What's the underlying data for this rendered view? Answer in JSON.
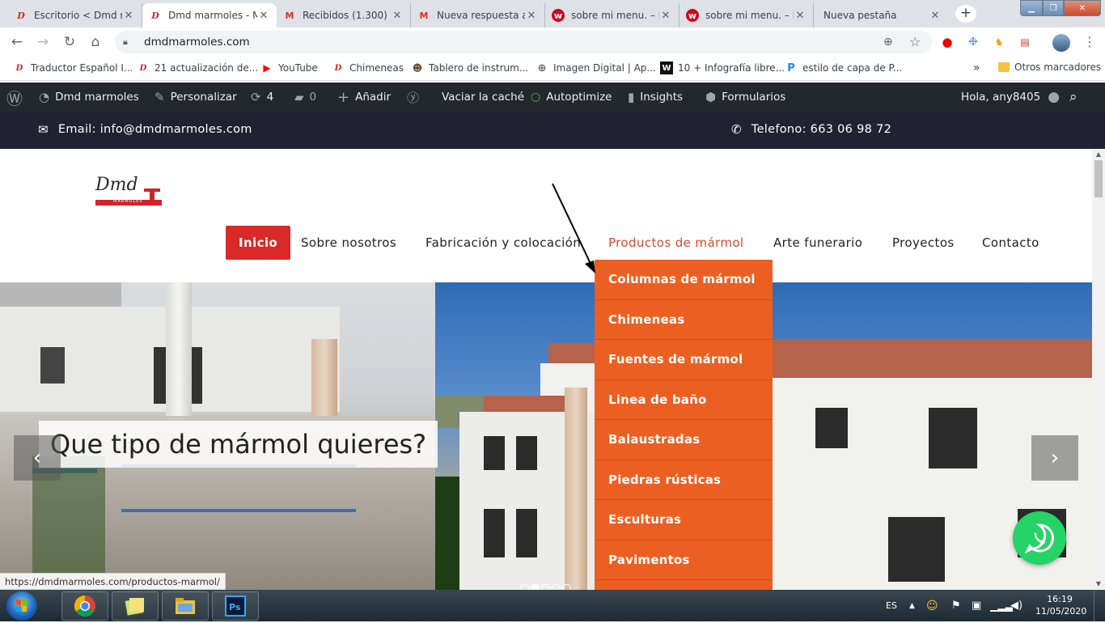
{
  "browser": {
    "tabs": [
      {
        "title": "Escritorio < Dmd m",
        "icon": "wp-icon"
      },
      {
        "title": "Dmd marmoles - M",
        "icon": "wp-icon",
        "active": true
      },
      {
        "title": "Recibidos (1.300) -",
        "icon": "gmail-icon"
      },
      {
        "title": "Nueva respuesta a",
        "icon": "gmail-icon"
      },
      {
        "title": "sobre mi menu. – P",
        "icon": "w-icon"
      },
      {
        "title": "sobre mi menu. – P",
        "icon": "w-icon"
      },
      {
        "title": "Nueva pestaña",
        "icon": ""
      }
    ],
    "new_tab": "+",
    "url": "dmdmarmoles.com",
    "bookmarks": [
      "Traductor Español I...",
      "21 actualización de...",
      "YouTube",
      "Chimeneas",
      "Tablero de instrum...",
      "Imagen Digital | Ap...",
      "10 + Infografía libre...",
      "estilo de capa de P..."
    ],
    "bookmarks_more": "»",
    "other_bookmarks": "Otros marcadores"
  },
  "wp_admin": {
    "site": "Dmd marmoles",
    "customize": "Personalizar",
    "updates": "4",
    "comments": "0",
    "add": "Añadir",
    "cache": "Vaciar la caché",
    "autoptimize": "Autoptimize",
    "insights": "Insights",
    "forms": "Formularios",
    "greeting": "Hola, any8405"
  },
  "topbar": {
    "email": "Email: info@dmdmarmoles.com",
    "phone": "Telefono: 663 06 98 72"
  },
  "logo": {
    "text": "Dmd",
    "sub": "MARMOLES"
  },
  "nav": [
    "Inicio",
    "Sobre nosotros",
    "Fabricación y colocación",
    "Productos de mármol",
    "Arte funerario",
    "Proyectos",
    "Contacto"
  ],
  "dropdown": [
    "Columnas de mármol",
    "Chimeneas",
    "Fuentes de mármol",
    "Linea de baño",
    "Balaustradas",
    "Piedras rústicas",
    "Esculturas",
    "Pavimentos"
  ],
  "slider": {
    "caption": "Que tipo de mármol quieres?",
    "prev": "‹",
    "next": "›"
  },
  "status_url": "https://dmdmarmoles.com/productos-marmol/",
  "taskbar": {
    "lang": "ES",
    "time": "16:19",
    "date": "11/05/2020"
  },
  "colors": {
    "accent_red": "#d92a29",
    "dropdown_orange": "#ec5f22",
    "topbar_dark": "#212131",
    "wp_admin": "#23282d",
    "whatsapp": "#25d366"
  }
}
